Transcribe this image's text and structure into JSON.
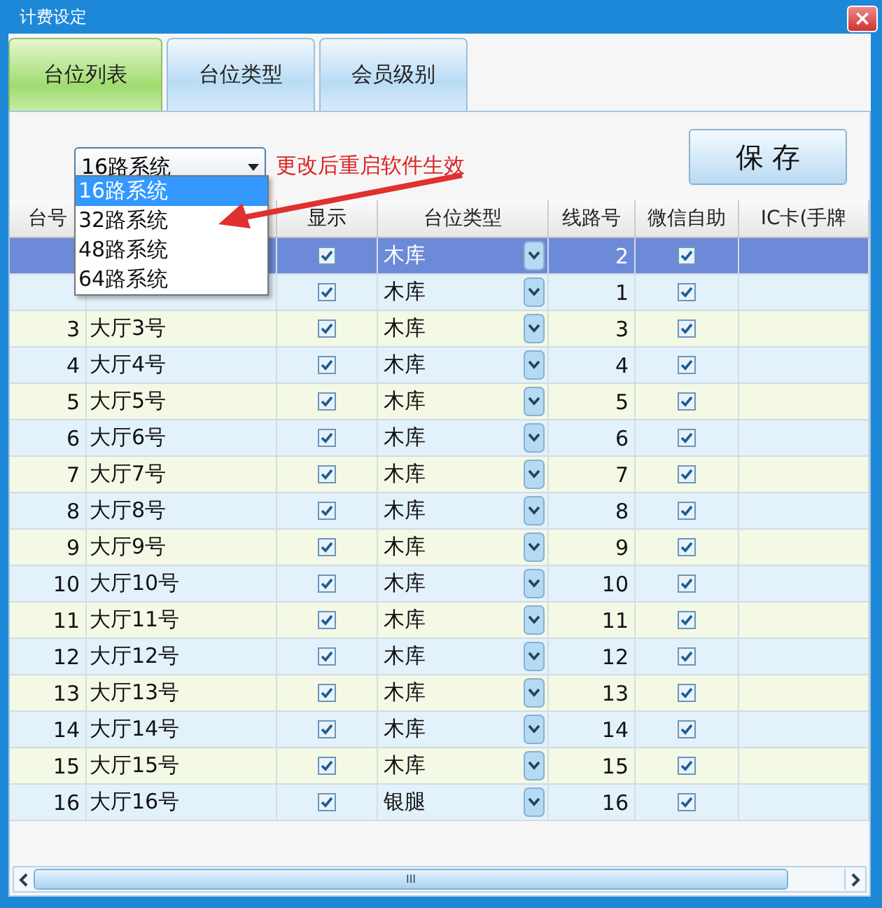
{
  "window": {
    "title": "计费设定",
    "close": "×"
  },
  "tabs": [
    {
      "label": "台位列表",
      "selected": true
    },
    {
      "label": "台位类型",
      "selected": false
    },
    {
      "label": "会员级别",
      "selected": false
    }
  ],
  "system_select": {
    "value": "16路系统",
    "options": [
      {
        "label": "16路系统",
        "selected": true
      },
      {
        "label": "32路系统",
        "selected": false
      },
      {
        "label": "48路系统",
        "selected": false
      },
      {
        "label": "64路系统",
        "selected": false
      }
    ],
    "expanded": true
  },
  "hint": "更改后重启软件生效",
  "save_button": "保 存",
  "table": {
    "columns": [
      "台号",
      "",
      "显示",
      "台位类型",
      "线路号",
      "微信自助",
      "IC卡(手牌"
    ],
    "rows": [
      {
        "line": "2",
        "type": "木库",
        "shown": true,
        "wechat": true,
        "selected": true
      },
      {
        "line": "1",
        "type": "木库",
        "shown": true,
        "wechat": true,
        "selected": false
      },
      {
        "number": "3",
        "name": "大厅3号",
        "type": "木库",
        "line": "3",
        "shown": true,
        "wechat": true,
        "selected": false
      },
      {
        "number": "4",
        "name": "大厅4号",
        "type": "木库",
        "line": "4",
        "shown": true,
        "wechat": true,
        "selected": false
      },
      {
        "number": "5",
        "name": "大厅5号",
        "type": "木库",
        "line": "5",
        "shown": true,
        "wechat": true,
        "selected": false
      },
      {
        "number": "6",
        "name": "大厅6号",
        "type": "木库",
        "line": "6",
        "shown": true,
        "wechat": true,
        "selected": false
      },
      {
        "number": "7",
        "name": "大厅7号",
        "type": "木库",
        "line": "7",
        "shown": true,
        "wechat": true,
        "selected": false
      },
      {
        "number": "8",
        "name": "大厅8号",
        "type": "木库",
        "line": "8",
        "shown": true,
        "wechat": true,
        "selected": false
      },
      {
        "number": "9",
        "name": "大厅9号",
        "type": "木库",
        "line": "9",
        "shown": true,
        "wechat": true,
        "selected": false
      },
      {
        "number": "10",
        "name": "大厅10号",
        "type": "木库",
        "line": "10",
        "shown": true,
        "wechat": true,
        "selected": false
      },
      {
        "number": "11",
        "name": "大厅11号",
        "type": "木库",
        "line": "11",
        "shown": true,
        "wechat": true,
        "selected": false
      },
      {
        "number": "12",
        "name": "大厅12号",
        "type": "木库",
        "line": "12",
        "shown": true,
        "wechat": true,
        "selected": false
      },
      {
        "number": "13",
        "name": "大厅13号",
        "type": "木库",
        "line": "13",
        "shown": true,
        "wechat": true,
        "selected": false
      },
      {
        "number": "14",
        "name": "大厅14号",
        "type": "木库",
        "line": "14",
        "shown": true,
        "wechat": true,
        "selected": false
      },
      {
        "number": "15",
        "name": "大厅15号",
        "type": "木库",
        "line": "15",
        "shown": true,
        "wechat": true,
        "selected": false
      },
      {
        "number": "16",
        "name": "大厅16号",
        "type": "银腿",
        "line": "16",
        "shown": true,
        "wechat": true,
        "selected": false
      }
    ]
  },
  "scrollbar": {
    "grip": "III"
  }
}
